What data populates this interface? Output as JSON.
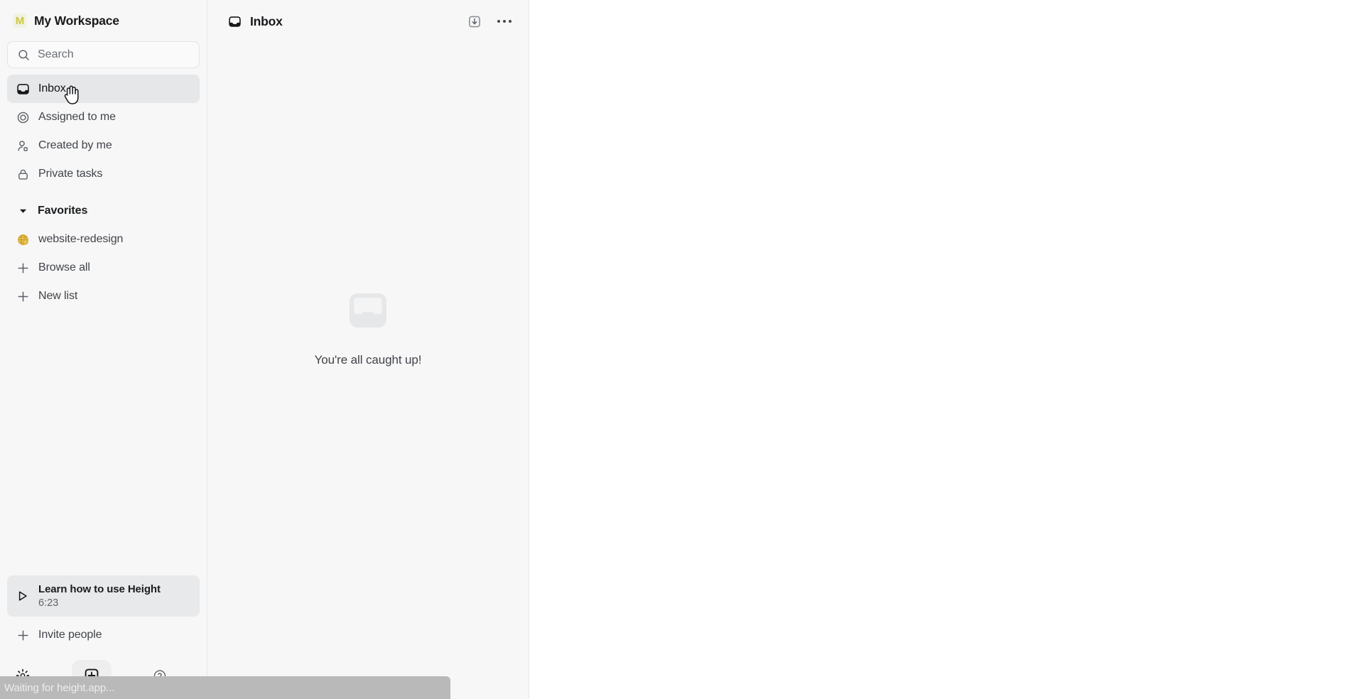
{
  "workspace": {
    "logo_letter": "M",
    "logo_color": "#c9c83f",
    "name": "My Workspace"
  },
  "search": {
    "placeholder": "Search",
    "value": "",
    "icon": "search-icon"
  },
  "sidebar": {
    "nav": [
      {
        "label": "Inbox",
        "icon": "inbox-icon",
        "active": true
      },
      {
        "label": "Assigned to me",
        "icon": "target-icon",
        "active": false
      },
      {
        "label": "Created by me",
        "icon": "person-icon",
        "active": false
      },
      {
        "label": "Private tasks",
        "icon": "lock-icon",
        "active": false
      }
    ],
    "favorites": {
      "label": "Favorites",
      "caret": "chevron-down-icon",
      "expanded": true,
      "items": [
        {
          "label": "website-redesign",
          "icon": "globe-icon",
          "icon_color": "#e0b43a"
        }
      ]
    },
    "actions": [
      {
        "label": "Browse all",
        "icon": "plus-icon"
      },
      {
        "label": "New list",
        "icon": "plus-icon"
      }
    ],
    "learn_card": {
      "icon": "play-icon",
      "title": "Learn how to use Height",
      "duration": "6:23"
    },
    "invite": {
      "label": "Invite people",
      "icon": "plus-icon"
    },
    "bottom_icons": [
      {
        "name": "settings-gear-icon"
      },
      {
        "name": "new-task-plus-icon"
      },
      {
        "name": "help-question-icon"
      }
    ]
  },
  "inbox_panel": {
    "icon": "inbox-icon",
    "title": "Inbox",
    "archive_all_icon": "download-box-icon",
    "more_icon": "more-horizontal-icon",
    "empty_state": {
      "icon": "inbox-empty-icon",
      "message": "You're all caught up!"
    }
  },
  "statusbar": {
    "text": "Waiting for height.app..."
  }
}
